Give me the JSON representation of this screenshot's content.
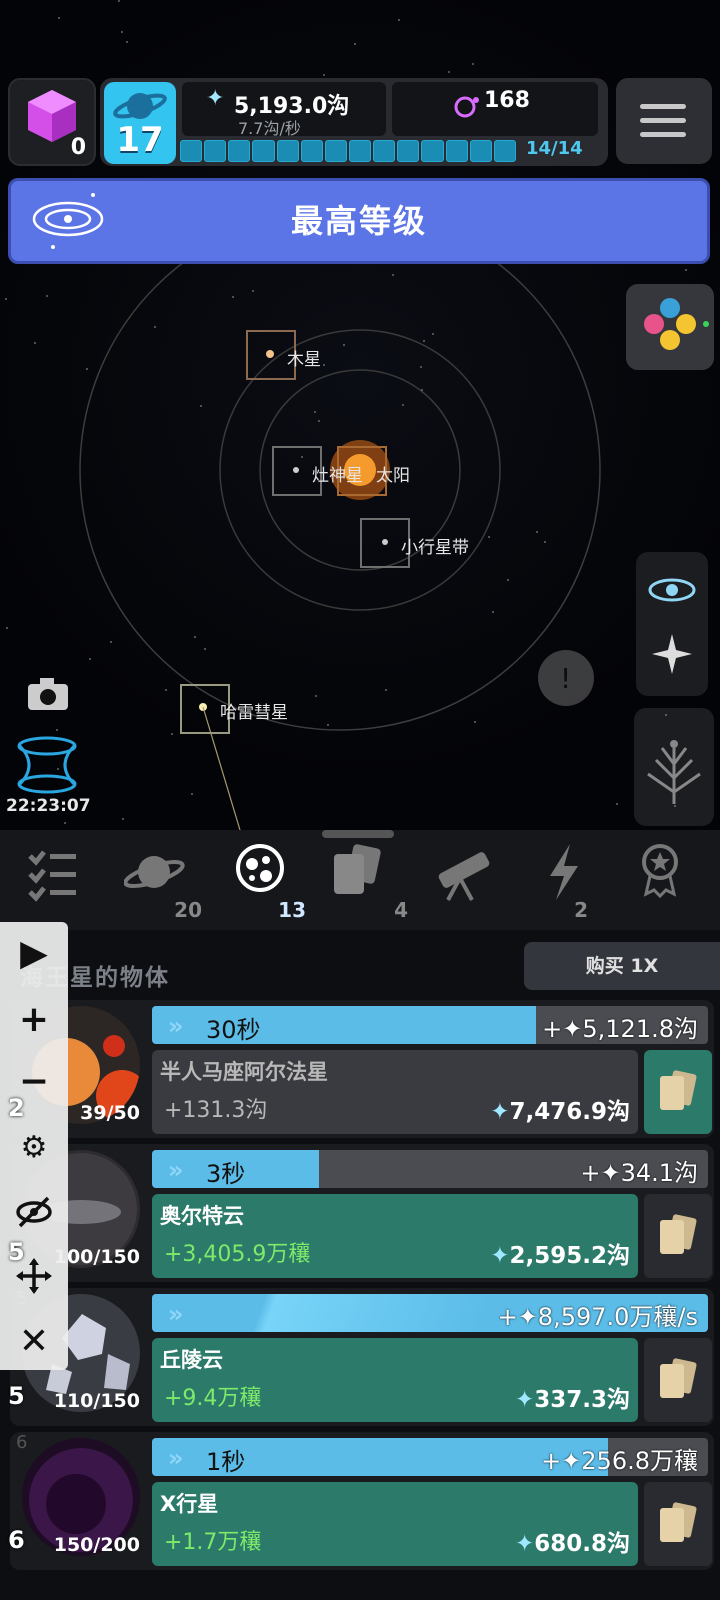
{
  "header": {
    "cube_count": "0",
    "level": "17",
    "stardust_value": "5,193.0沟",
    "stardust_rate": "7.7沟/秒",
    "gem_value": "168",
    "progress_segments": 14,
    "progress_label": "14/14"
  },
  "banner": {
    "text": "最高等级"
  },
  "map": {
    "labels": [
      "木星",
      "灶神星",
      "太阳",
      "小行星带",
      "哈雷彗星"
    ],
    "timer": "22:23:07"
  },
  "tabs": [
    {
      "icon": "checklist-icon",
      "count": ""
    },
    {
      "icon": "planet-icon",
      "count": "20"
    },
    {
      "icon": "cells-icon",
      "count": "13",
      "active": true
    },
    {
      "icon": "cards-icon",
      "count": "4"
    },
    {
      "icon": "telescope-icon",
      "count": ""
    },
    {
      "icon": "lightning-icon",
      "count": "2"
    },
    {
      "icon": "medal-icon",
      "count": ""
    }
  ],
  "section": {
    "title": "海王星的物体",
    "buy_label": "购买 1X"
  },
  "items": [
    {
      "level_small": "",
      "count": "39/50",
      "time": "30秒",
      "progress": 0.69,
      "gain": "+✦5,121.8沟",
      "name": "半人马座阿尔法星",
      "increment": "+131.3沟",
      "cost": "7,476.9沟",
      "affordable": false
    },
    {
      "level_small": "",
      "count": "100/150",
      "time": "3秒",
      "progress": 0.3,
      "gain": "+✦34.1沟",
      "name": "奥尔特云",
      "increment": "+3,405.9万穰",
      "cost": "2,595.2沟",
      "affordable": true
    },
    {
      "level_small": "5",
      "count": "110/150",
      "time": "",
      "progress": 1.0,
      "gain": "+✦8,597.0万穰/s",
      "name": "丘陵云",
      "increment": "+9.4万穰",
      "cost": "337.3沟",
      "affordable": true
    },
    {
      "level_small": "6",
      "count": "150/200",
      "time": "1秒",
      "progress": 0.82,
      "gain": "+✦256.8万穰",
      "name": "X行星",
      "increment": "+1.7万穰",
      "cost": "680.8沟",
      "affordable": true
    }
  ],
  "overlay": {
    "numbers": [
      "2",
      "5",
      "5",
      "6"
    ]
  }
}
